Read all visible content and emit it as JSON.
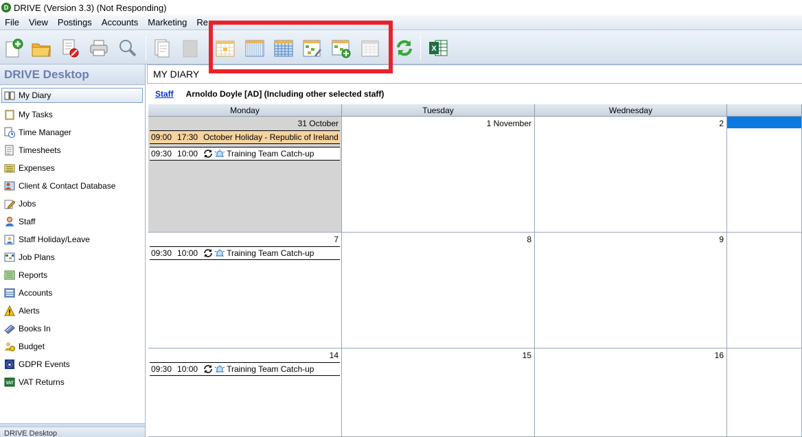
{
  "window": {
    "title": "DRIVE (Version 3.3) (Not Responding)",
    "logo_letter": "D"
  },
  "menu": [
    "File",
    "View",
    "Postings",
    "Accounts",
    "Marketing",
    "Re"
  ],
  "sidebar": {
    "title": "DRIVE Desktop",
    "footer": "DRIVE Desktop",
    "items": [
      {
        "label": "My Diary",
        "icon": "book-icon"
      },
      {
        "label": "My Tasks",
        "icon": "clipboard-icon"
      },
      {
        "label": "Time Manager",
        "icon": "clock-icon"
      },
      {
        "label": "Timesheets",
        "icon": "timesheet-icon"
      },
      {
        "label": "Expenses",
        "icon": "expenses-icon"
      },
      {
        "label": "Client & Contact Database",
        "icon": "contacts-icon"
      },
      {
        "label": "Jobs",
        "icon": "pencil-icon"
      },
      {
        "label": "Staff",
        "icon": "person-icon"
      },
      {
        "label": "Staff Holiday/Leave",
        "icon": "holiday-icon"
      },
      {
        "label": "Job Plans",
        "icon": "grid-icon"
      },
      {
        "label": "Reports",
        "icon": "report-icon"
      },
      {
        "label": "Accounts",
        "icon": "ledger-icon"
      },
      {
        "label": "Alerts",
        "icon": "warning-icon"
      },
      {
        "label": "Books In",
        "icon": "books-icon"
      },
      {
        "label": "Budget",
        "icon": "budget-icon"
      },
      {
        "label": "GDPR Events",
        "icon": "gdpr-icon"
      },
      {
        "label": "VAT Returns",
        "icon": "vat-icon"
      }
    ]
  },
  "main": {
    "page_title": "MY DIARY",
    "staff_link": "Staff",
    "staff_text": "Arnoldo Doyle [AD]  (Including other selected staff)",
    "days": [
      "Monday",
      "Tuesday",
      "Wednesday"
    ],
    "weeks": [
      {
        "dates": [
          "31 October",
          "1 November",
          "2"
        ],
        "events": [
          {
            "start": "09:00",
            "end": "17:30",
            "title": "October Holiday - Republic of Ireland",
            "kind": "holiday"
          },
          {
            "start": "09:30",
            "end": "10:00",
            "title": "Training Team Catch-up",
            "kind": "meeting"
          }
        ]
      },
      {
        "dates": [
          "7",
          "8",
          "9"
        ],
        "events": [
          {
            "start": "09:30",
            "end": "10:00",
            "title": "Training Team Catch-up",
            "kind": "meeting"
          }
        ]
      },
      {
        "dates": [
          "14",
          "15",
          "16"
        ],
        "events": [
          {
            "start": "09:30",
            "end": "10:00",
            "title": "Training Team Catch-up",
            "kind": "meeting"
          }
        ]
      }
    ]
  },
  "colors": {
    "highlight": "#e8232a",
    "holiday": "#f6d39f",
    "today_grey": "#d4d4d4",
    "selection_blue": "#0a7ae0"
  }
}
